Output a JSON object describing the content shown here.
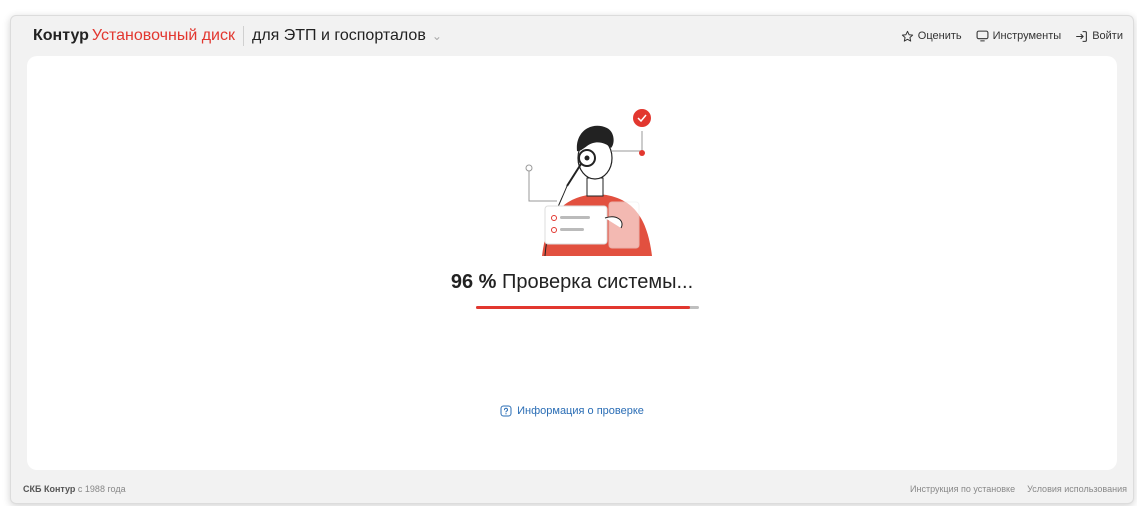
{
  "header": {
    "brand_company": "Контур",
    "brand_product": "Установочный диск",
    "context_label": "для ЭТП и госпорталов",
    "actions": {
      "rate": "Оценить",
      "tools": "Инструменты",
      "login": "Войти"
    }
  },
  "main": {
    "progress_percent_label": "96 %",
    "progress_status": "Проверка системы...",
    "progress_value": 96,
    "info_link": "Информация о проверке"
  },
  "footer": {
    "company": "СКБ Контур",
    "since": "с 1988 года",
    "links": {
      "install_guide": "Инструкция по установке",
      "terms": "Условия использования"
    }
  },
  "colors": {
    "accent": "#e2372f",
    "link": "#2a6db5",
    "panel": "#f2f2f2"
  }
}
